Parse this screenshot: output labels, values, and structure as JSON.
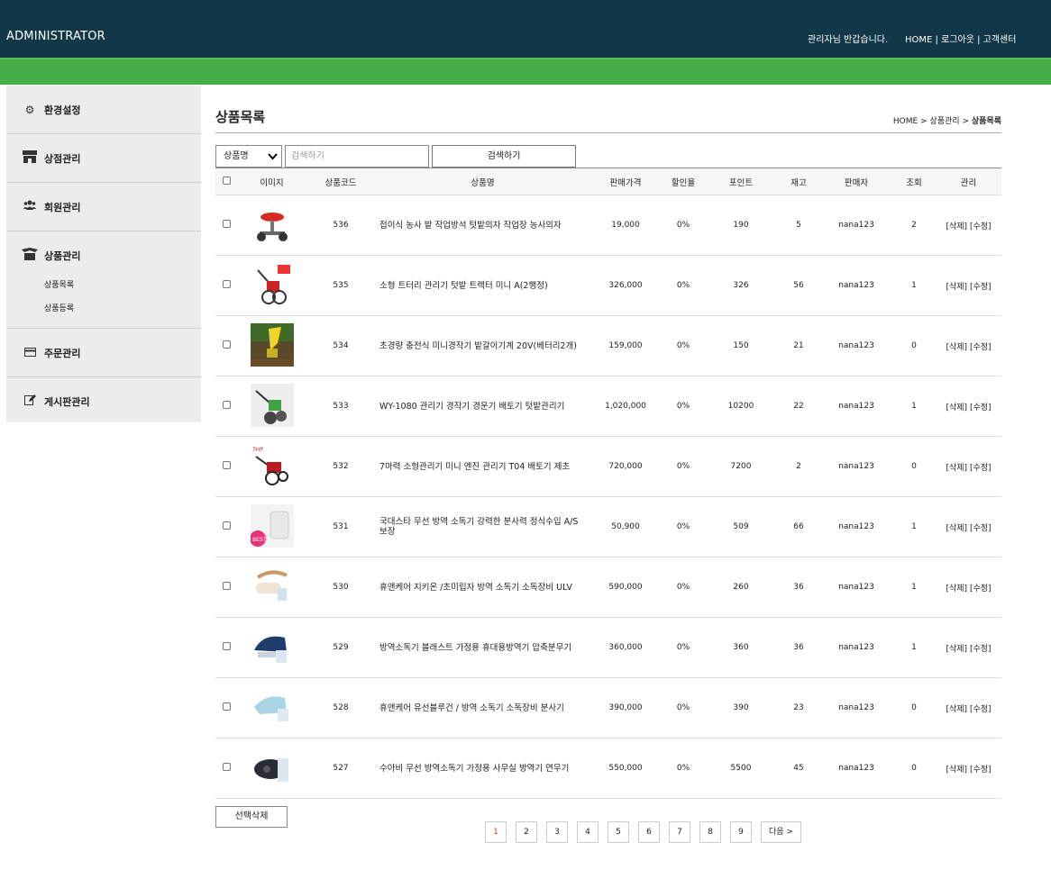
{
  "header": {
    "brand": "ADMINISTRATOR",
    "welcome": "관리자님 반갑습니다.",
    "links": [
      "HOME",
      "로그아웃",
      "고객센터"
    ],
    "sep": "|",
    "colors": {
      "top": "#123746",
      "green": "#45ae48"
    }
  },
  "sidebar": {
    "items": [
      {
        "label": "환경설정",
        "icon": "gears-icon"
      },
      {
        "label": "상점관리",
        "icon": "store-icon"
      },
      {
        "label": "회원관리",
        "icon": "users-icon"
      },
      {
        "label": "상품관리",
        "icon": "box-icon",
        "sub": [
          "상품목록",
          "상품등록"
        ]
      },
      {
        "label": "주문관리",
        "icon": "credit-card-icon"
      },
      {
        "label": "게시판관리",
        "icon": "edit-icon"
      }
    ]
  },
  "page": {
    "title": "상품목록",
    "breadcrumb": [
      "HOME",
      "상품관리",
      "상품목록"
    ],
    "crumb_sep": ">"
  },
  "search": {
    "select_value": "상품명",
    "placeholder": "검색하기",
    "button": "검색하기"
  },
  "table": {
    "headers": [
      "이미지",
      "상품코드",
      "상품명",
      "판매가격",
      "할인율",
      "포인트",
      "재고",
      "판매자",
      "조회",
      "관리"
    ],
    "actions": [
      "[삭제]",
      "[수정]"
    ],
    "rows": [
      {
        "code": "536",
        "name": "접이식 농사 밭 작업방석 텃밭의자 작업장 농사의자",
        "price": "19,000",
        "discount": "0%",
        "point": "190",
        "stock": "5",
        "seller": "nana123",
        "views": "2",
        "thumb": "seat"
      },
      {
        "code": "535",
        "name": "소형 트터리 관리기 텃밭 트렉터 미니 A(2행정)",
        "price": "326,000",
        "discount": "0%",
        "point": "326",
        "stock": "56",
        "seller": "nana123",
        "views": "1",
        "thumb": "tiller"
      },
      {
        "code": "534",
        "name": "초경량 충전식 미니경작기 밭갈이기계 20V(베터리2개)",
        "price": "159,000",
        "discount": "0%",
        "point": "150",
        "stock": "21",
        "seller": "nana123",
        "views": "0",
        "thumb": "yellow"
      },
      {
        "code": "533",
        "name": "WY-1080 관리기 경작기 경운기 배토기 텃밭관리기",
        "price": "1,020,000",
        "discount": "0%",
        "point": "10200",
        "stock": "22",
        "seller": "nana123",
        "views": "1",
        "thumb": "green"
      },
      {
        "code": "532",
        "name": "7마력 소형관리기 미니 엔진 관리기 T04 배토기 제초",
        "price": "720,000",
        "discount": "0%",
        "point": "7200",
        "stock": "2",
        "seller": "nana123",
        "views": "0",
        "thumb": "redtiller"
      },
      {
        "code": "531",
        "name": "국대스타 무선 방역 소독기 강력한 분사력 정식수입 A/S 보장",
        "price": "50,900",
        "discount": "0%",
        "point": "509",
        "stock": "66",
        "seller": "nana123",
        "views": "1",
        "thumb": "best"
      },
      {
        "code": "530",
        "name": "휴앤케어 지키온 /초미립자 방역 소독기 소독장비 ULV",
        "price": "590,000",
        "discount": "0%",
        "point": "260",
        "stock": "36",
        "seller": "nana123",
        "views": "1",
        "thumb": "sprayer"
      },
      {
        "code": "529",
        "name": "방역소독기 블래스트 가정용 휴대용방역기 압축분무기",
        "price": "360,000",
        "discount": "0%",
        "point": "360",
        "stock": "36",
        "seller": "nana123",
        "views": "1",
        "thumb": "navy"
      },
      {
        "code": "528",
        "name": "휴앤케어 유선블루건 / 방역 소독기 소독장비 분사기",
        "price": "390,000",
        "discount": "0%",
        "point": "390",
        "stock": "23",
        "seller": "nana123",
        "views": "0",
        "thumb": "blue"
      },
      {
        "code": "527",
        "name": "수아비 무선 방역소독기 가정용 사무실 방역기 연무기",
        "price": "550,000",
        "discount": "0%",
        "point": "5500",
        "stock": "45",
        "seller": "nana123",
        "views": "0",
        "thumb": "dark"
      }
    ]
  },
  "bottom": {
    "delete_selected": "선택삭제",
    "pages": [
      "1",
      "2",
      "3",
      "4",
      "5",
      "6",
      "7",
      "8",
      "9"
    ],
    "current_page": "1",
    "next": "다음 >"
  }
}
